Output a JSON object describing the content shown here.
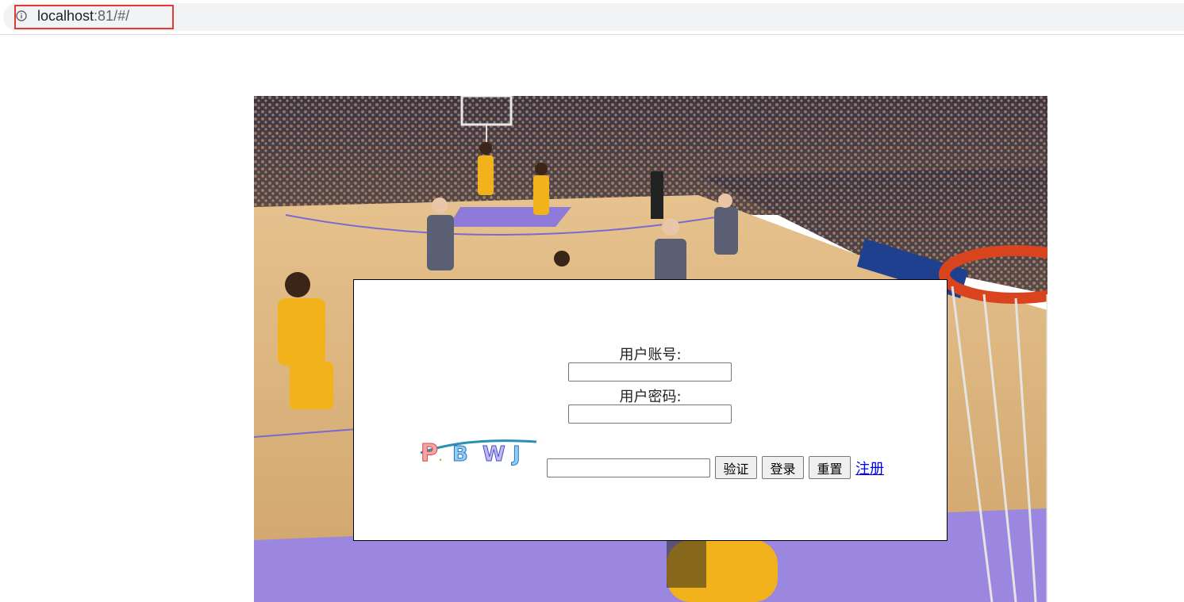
{
  "browser": {
    "url_host": "localhost",
    "url_rest": ":81/#/",
    "info_icon": "info-circle-icon"
  },
  "background": {
    "description_icon": "basketball-court-photo"
  },
  "login": {
    "username_label": "用户账号:",
    "username_value": "",
    "password_label": "用户密码:",
    "password_value": "",
    "captcha_text": "P.BWJ",
    "captcha_input_value": "",
    "verify_button": "验证",
    "login_button": "登录",
    "reset_button": "重置",
    "register_link": "注册"
  },
  "colors": {
    "link": "#0000ee",
    "highlight_border": "#e53935",
    "court_floor": "#d9b27a",
    "lane_paint": "#8e7ad9",
    "jersey_gold": "#f2b21c"
  }
}
